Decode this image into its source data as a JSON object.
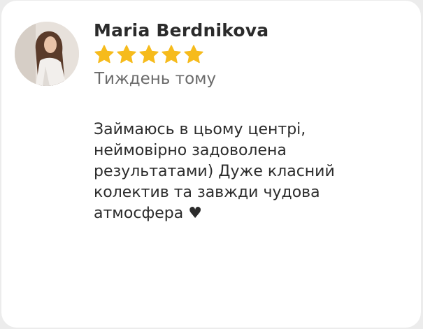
{
  "review": {
    "author_name": "Maria Berdnikova",
    "rating": 5,
    "rating_max": 5,
    "date_text": "Тиждень тому",
    "text": "Займаюсь в цьому центрі,\nнеймовірно задоволена\nрезультатами) Дуже класний\nколектив та завжди чудова\nатмосфера ♥"
  },
  "icons": {
    "avatar": "user-photo",
    "star": "star-icon"
  },
  "colors": {
    "star": "#f6bb1c",
    "name": "#2b2b2b",
    "date": "#6b6b6b",
    "text": "#2c2c2c",
    "card": "#ffffff"
  }
}
